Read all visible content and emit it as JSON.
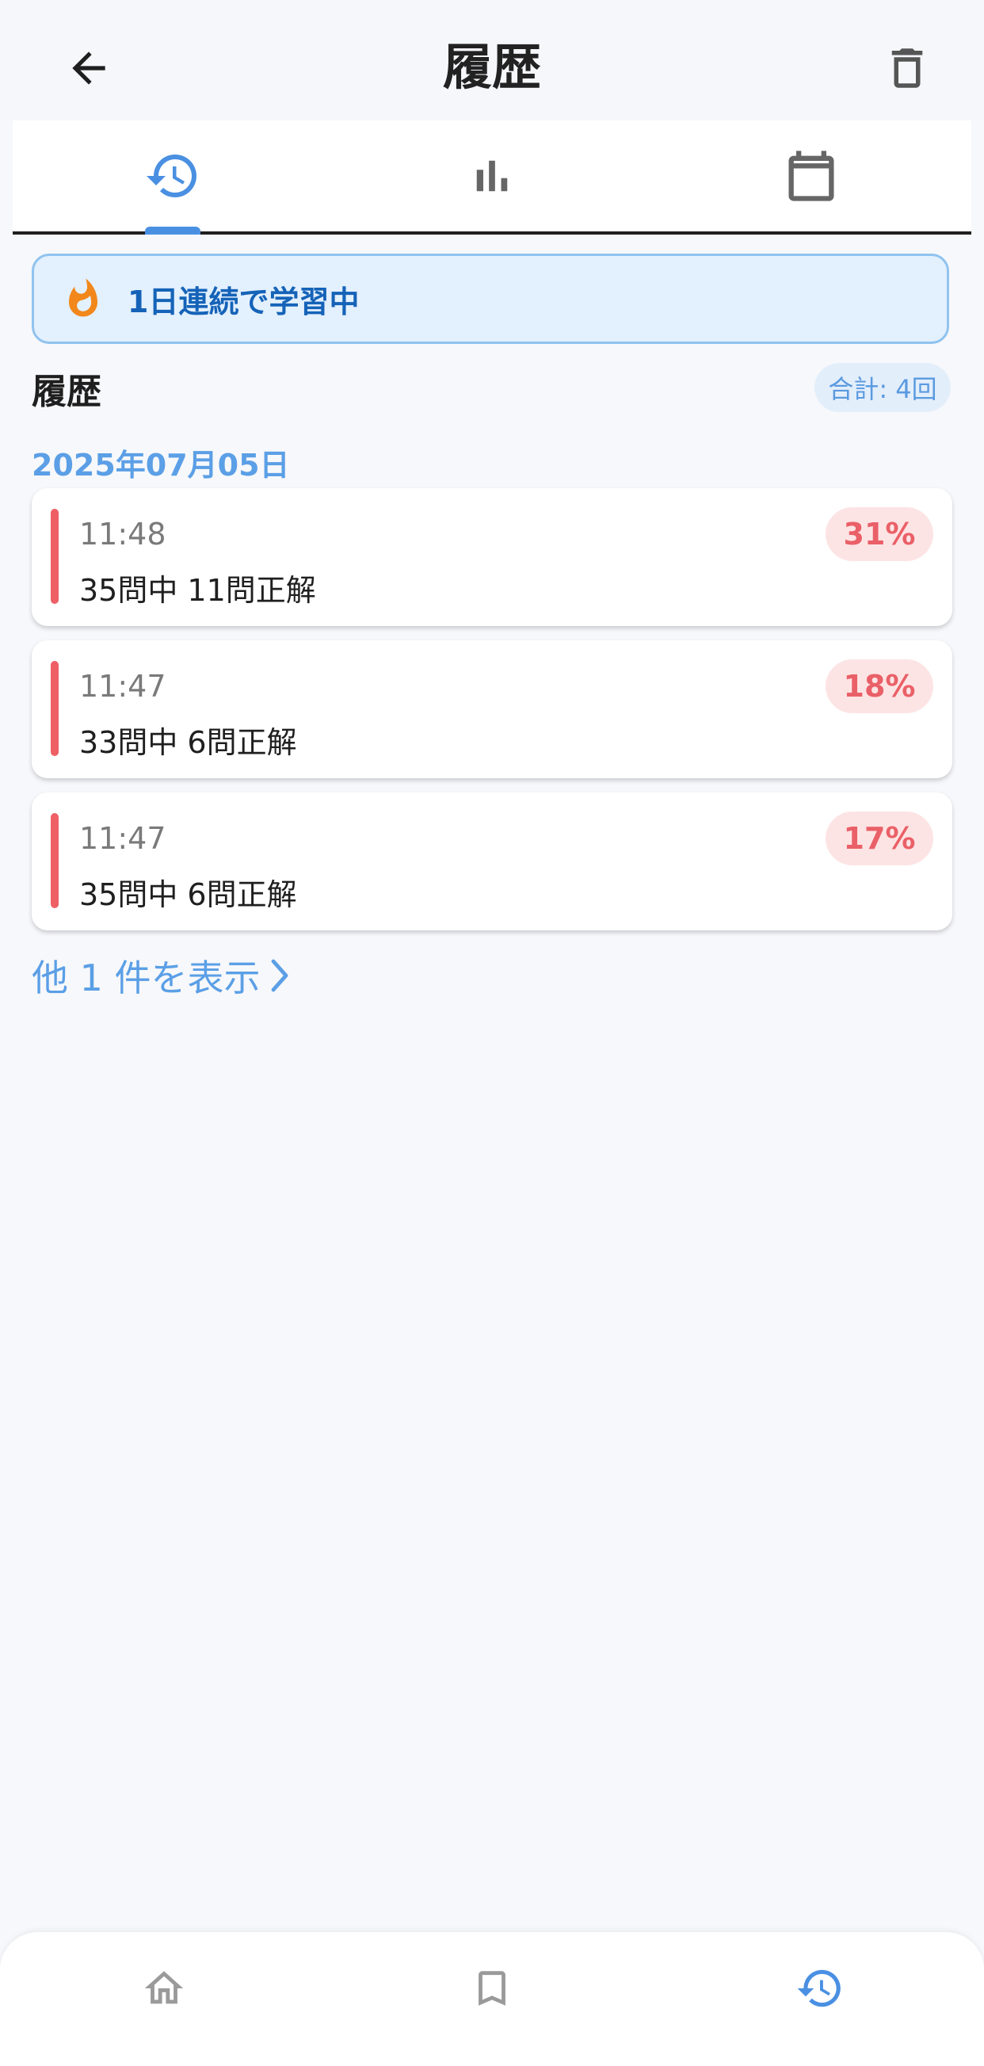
{
  "app_bar": {
    "title": "履歴",
    "back_icon": "arrow-back-icon",
    "delete_icon": "trash-icon"
  },
  "tabs": [
    {
      "icon": "history-icon",
      "active": true
    },
    {
      "icon": "bar-chart-icon",
      "active": false
    },
    {
      "icon": "calendar-icon",
      "active": false
    }
  ],
  "streak": {
    "icon": "fire-icon",
    "text": "1日連続で学習中"
  },
  "history": {
    "section_title": "履歴",
    "total_label": "合計: 4回",
    "date": "2025年07月05日",
    "items": [
      {
        "time": "11:48",
        "result": "35問中 11問正解",
        "percent": "31%"
      },
      {
        "time": "11:47",
        "result": "33問中 6問正解",
        "percent": "18%"
      },
      {
        "time": "11:47",
        "result": "35問中 6問正解",
        "percent": "17%"
      }
    ],
    "show_more": "他 1 件を表示"
  },
  "bottom_nav": [
    {
      "icon": "home-icon",
      "active": false
    },
    {
      "icon": "bookmark-icon",
      "active": false
    },
    {
      "icon": "history-icon",
      "active": true
    }
  ],
  "colors": {
    "accent": "#4a90e2",
    "streak_text": "#1563b8",
    "score_low": "#ef5f66",
    "score_low_bg": "#fde4e4"
  }
}
